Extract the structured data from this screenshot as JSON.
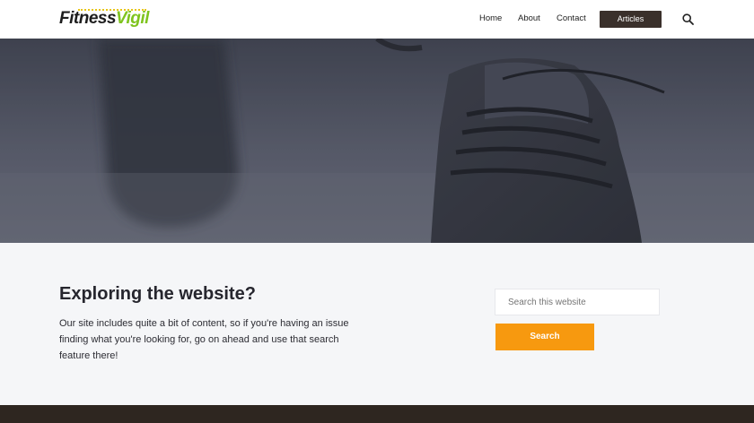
{
  "header": {
    "logo_part1": "Fitness",
    "logo_part2": "Vigil",
    "nav": [
      {
        "label": "Home"
      },
      {
        "label": "About"
      },
      {
        "label": "Contact"
      },
      {
        "label": "Articles"
      }
    ],
    "search_icon": "search-icon"
  },
  "hero": {
    "image": "close-up of a dark gray running sneaker with laces on a gray floor"
  },
  "content": {
    "heading": "Exploring the website?",
    "paragraph": "Our site includes quite a bit of content, so if you're having an issue finding what you're looking for, go on ahead and use that search feature there!",
    "search_placeholder": "Search this website",
    "search_button": "Search"
  },
  "colors": {
    "accent": "#f7990f",
    "logo_green": "#7fc41f",
    "dark_button": "#3a302b",
    "footer": "#2e2620"
  }
}
